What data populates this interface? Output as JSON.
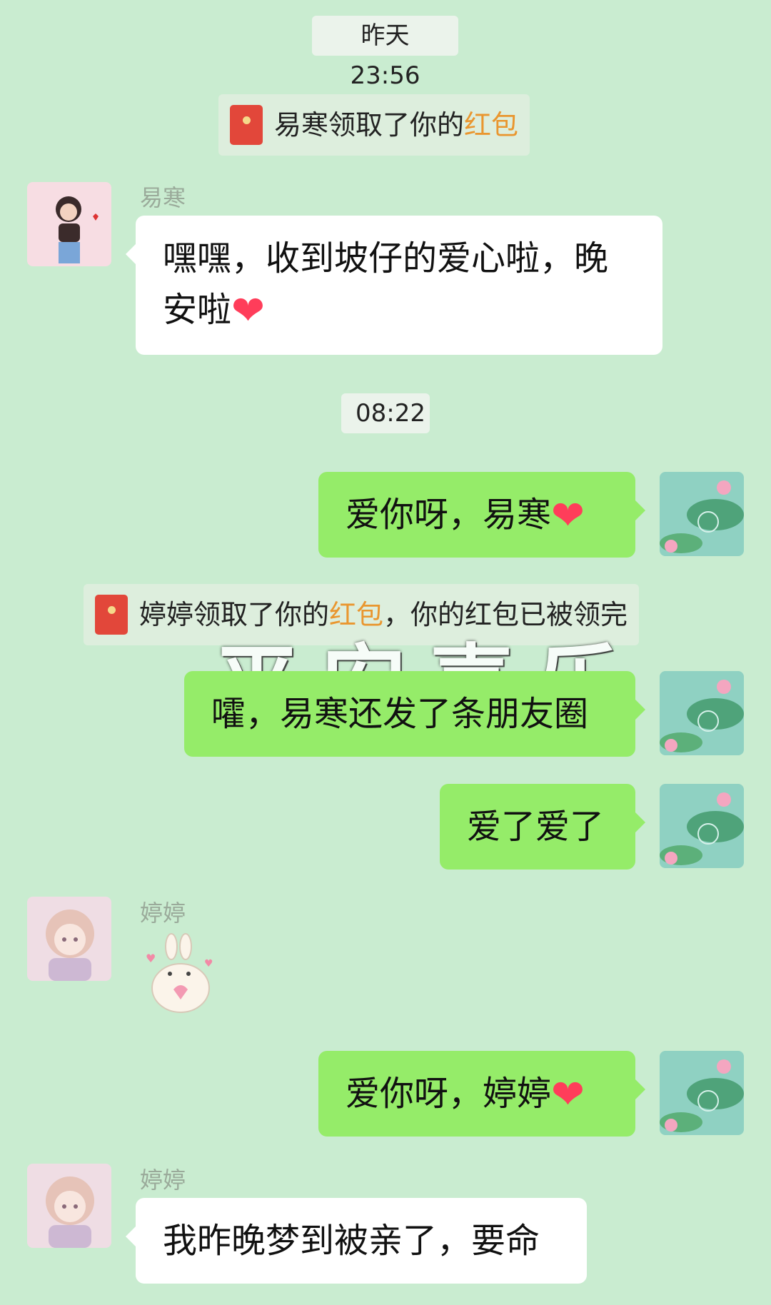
{
  "timestamps": [
    "昨天 23:56",
    "08:22"
  ],
  "system_messages": [
    {
      "prefix": "易寒领取了你的",
      "link": "红包",
      "suffix": ""
    },
    {
      "prefix": "婷婷领取了你的",
      "link": "红包",
      "suffix": "，你的红包已被领完"
    }
  ],
  "watermark": "平安喜乐",
  "messages": [
    {
      "sender": "易寒",
      "text": "嘿嘿，收到坡仔的爱心啦，晚安啦",
      "emoji": "❤"
    },
    {
      "sender": "me",
      "text": "爱你呀，易寒",
      "emoji": "❤"
    },
    {
      "sender": "me",
      "text": "嚯，易寒还发了条朋友圈",
      "emoji": ""
    },
    {
      "sender": "me",
      "text": "爱了爱了",
      "emoji": ""
    },
    {
      "sender": "婷婷",
      "sticker": "bunny-heart-sticker"
    },
    {
      "sender": "me",
      "text": "爱你呀，婷婷",
      "emoji": "❤"
    },
    {
      "sender": "婷婷",
      "text": "我昨晚梦到被亲了，要命",
      "emoji": ""
    }
  ],
  "colors": {
    "background": "#c9ecd0",
    "outgoing": "#95ec69",
    "incoming": "#ffffff",
    "red_packet_link": "#e9962f"
  }
}
